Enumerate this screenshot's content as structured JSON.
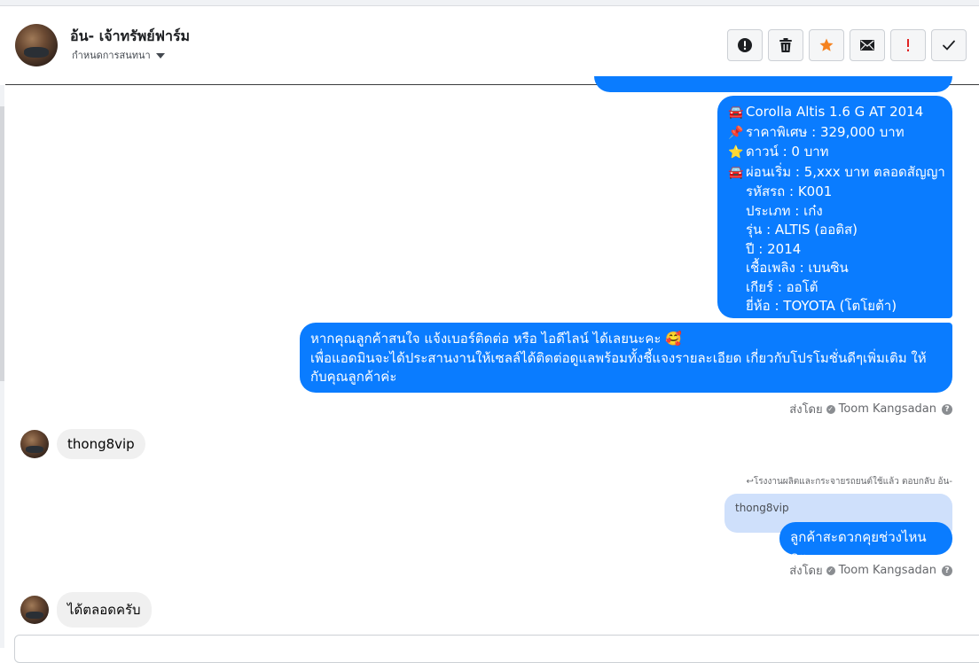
{
  "header": {
    "contact_name": "อ้น- เจ้าทรัพย์ฟาร์ม",
    "subtitle": "กำหนดการสนทนา"
  },
  "toolbar": {
    "buttons": [
      {
        "name": "report-spam",
        "icon": "alert-circle-icon"
      },
      {
        "name": "delete",
        "icon": "trash-icon"
      },
      {
        "name": "star",
        "icon": "star-icon",
        "color": "#f5821f"
      },
      {
        "name": "mark-unread",
        "icon": "envelope-icon"
      },
      {
        "name": "important",
        "icon": "exclamation-icon",
        "color": "#e02424"
      },
      {
        "name": "mark-done",
        "icon": "checkmark-icon"
      }
    ]
  },
  "messages": {
    "car_listing": {
      "lines": [
        {
          "emoji": "🚘",
          "text": "Corolla Altis 1.6 G  AT 2014"
        },
        {
          "emoji": "📌",
          "text": "ราคาพิเศษ : 329,000 บาท"
        },
        {
          "emoji": "⭐",
          "text": "ดาวน์ : 0 บาท"
        },
        {
          "emoji": "🚘",
          "text": "ผ่อนเริ่ม : 5,xxx บาท ตลอดสัญญา"
        },
        {
          "emoji": "",
          "text": "รหัสรถ : K001"
        },
        {
          "emoji": "",
          "text": "ประเภท : เก๋ง"
        },
        {
          "emoji": "",
          "text": "รุ่น : ALTIS (ออติส)"
        },
        {
          "emoji": "",
          "text": "ปี : 2014"
        },
        {
          "emoji": "",
          "text": "เชื้อเพลิง : เบนซิน"
        },
        {
          "emoji": "",
          "text": "เกียร์ : ออโต้"
        },
        {
          "emoji": "",
          "text": "ยี่ห้อ : TOYOTA (โตโยต้า)"
        }
      ]
    },
    "contact_prompt": {
      "line1": "หากคุณลูกค้าสนใจ แจ้งเบอร์ติดต่อ หรือ ไอดีไลน์ ได้เลยนะคะ 🥰",
      "line2": "เพื่อแอดมินจะได้ประสานงานให้เซลล์ได้ติดต่อดูแลพร้อมทั้งชี้แจงรายละเอียด เกี่ยวกับโปรโมชั่นดีๆเพิ่มเติม ให้กับคุณลูกค้าค่ะ"
    },
    "sent_by_1": {
      "prefix": "ส่งโดย",
      "name": "Toom Kangsadan"
    },
    "incoming_1": "thong8vip",
    "reply_note": "↩โรงงานผลิตและกระจายรถยนต์ใช้แล้ว ตอบกลับ อ้น-",
    "quoted_text": "thong8vip",
    "outgoing_reply": "ลูกค้าสะดวกคุยช่วงไหนคะ",
    "sent_by_2": {
      "prefix": "ส่งโดย",
      "name": "Toom Kangsadan"
    },
    "incoming_2": "ได้ตลอดครับ"
  }
}
